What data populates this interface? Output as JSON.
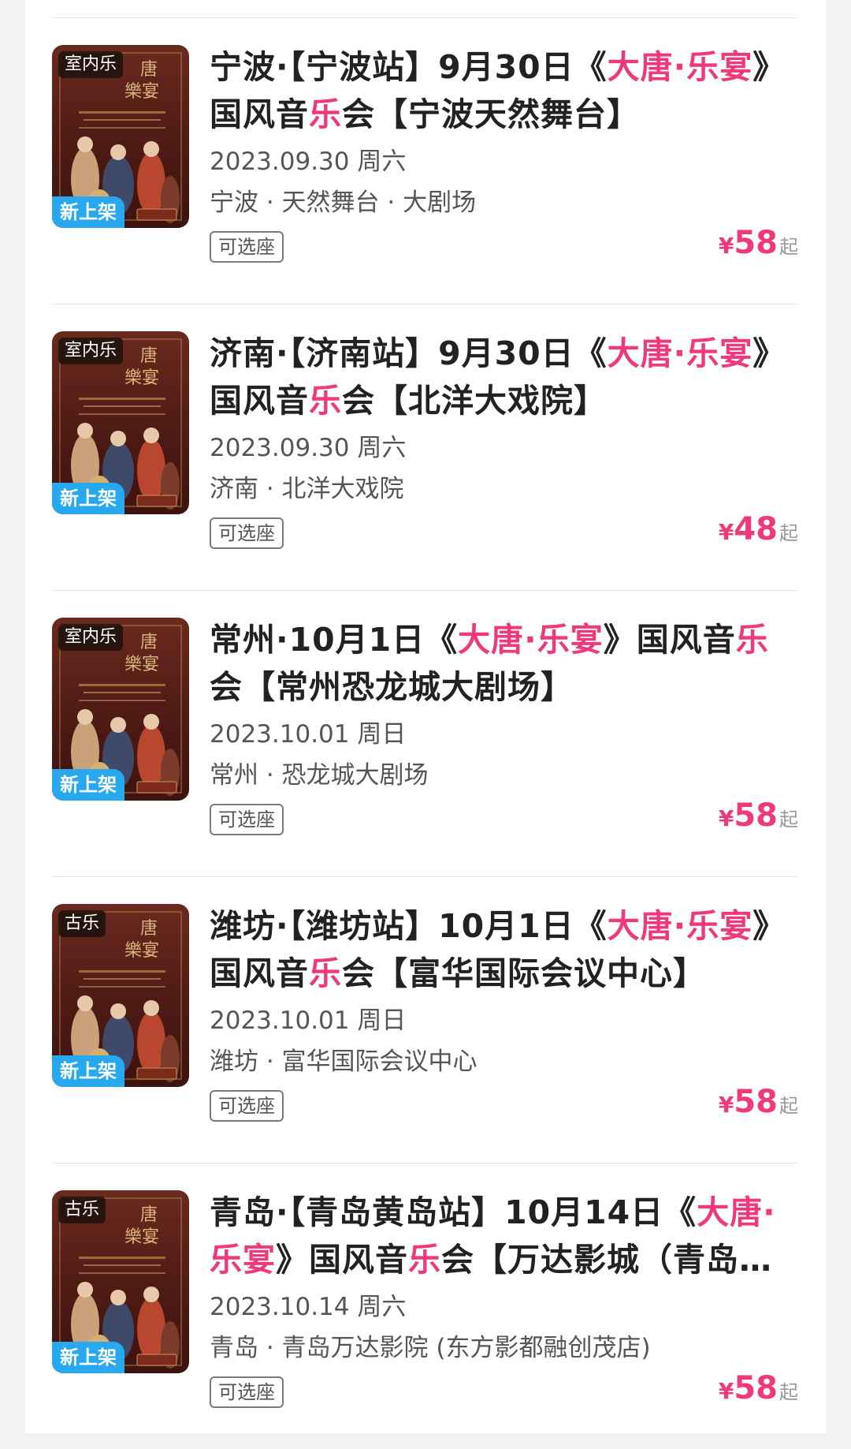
{
  "events": [
    {
      "title_parts": [
        {
          "t": "宁波·【宁波站】9月30日《",
          "hl": false
        },
        {
          "t": "大唐·乐宴",
          "hl": true
        },
        {
          "t": "》国风音",
          "hl": false
        },
        {
          "t": "乐",
          "hl": true
        },
        {
          "t": "会【宁波天然舞台】",
          "hl": false
        }
      ],
      "tag_top": "室内乐",
      "tag_bottom": "新上架",
      "date": "2023.09.30 周六",
      "venue": "宁波 · 天然舞台 · 大剧场",
      "seat_label": "可选座",
      "price_currency": "¥",
      "price": "58",
      "price_suffix": "起"
    },
    {
      "title_parts": [
        {
          "t": "济南·【济南站】9月30日《",
          "hl": false
        },
        {
          "t": "大唐·乐宴",
          "hl": true
        },
        {
          "t": "》国风音",
          "hl": false
        },
        {
          "t": "乐",
          "hl": true
        },
        {
          "t": "会【北洋大戏院】",
          "hl": false
        }
      ],
      "tag_top": "室内乐",
      "tag_bottom": "新上架",
      "date": "2023.09.30 周六",
      "venue": "济南 · 北洋大戏院",
      "seat_label": "可选座",
      "price_currency": "¥",
      "price": "48",
      "price_suffix": "起"
    },
    {
      "title_parts": [
        {
          "t": "常州·10月1日《",
          "hl": false
        },
        {
          "t": "大唐·乐宴",
          "hl": true
        },
        {
          "t": "》国风音",
          "hl": false
        },
        {
          "t": "乐",
          "hl": true
        },
        {
          "t": "会【常州恐龙城大剧场】",
          "hl": false
        }
      ],
      "tag_top": "室内乐",
      "tag_bottom": "新上架",
      "date": "2023.10.01 周日",
      "venue": "常州 · 恐龙城大剧场",
      "seat_label": "可选座",
      "price_currency": "¥",
      "price": "58",
      "price_suffix": "起"
    },
    {
      "title_parts": [
        {
          "t": "潍坊·【潍坊站】10月1日《",
          "hl": false
        },
        {
          "t": "大唐·乐宴",
          "hl": true
        },
        {
          "t": "》国风音",
          "hl": false
        },
        {
          "t": "乐",
          "hl": true
        },
        {
          "t": "会【富华国际会议中心】",
          "hl": false
        }
      ],
      "tag_top": "古乐",
      "tag_bottom": "新上架",
      "date": "2023.10.01 周日",
      "venue": "潍坊 · 富华国际会议中心",
      "seat_label": "可选座",
      "price_currency": "¥",
      "price": "58",
      "price_suffix": "起"
    },
    {
      "title_parts": [
        {
          "t": "青岛·【青岛黄岛站】10月14日《",
          "hl": false
        },
        {
          "t": "大唐·乐宴",
          "hl": true
        },
        {
          "t": "》国风音",
          "hl": false
        },
        {
          "t": "乐",
          "hl": true
        },
        {
          "t": "会【万达影城（青岛东方影都融创茂店）】",
          "hl": false
        }
      ],
      "tag_top": "古乐",
      "tag_bottom": "新上架",
      "date": "2023.10.14 周六",
      "venue": "青岛 · 青岛万达影院 (东方影都融创茂店)",
      "seat_label": "可选座",
      "price_currency": "¥",
      "price": "58",
      "price_suffix": "起"
    }
  ],
  "colors": {
    "accent": "#f0397a",
    "badge_new": "#28a9ef",
    "poster_bg": "#5a1f17"
  }
}
